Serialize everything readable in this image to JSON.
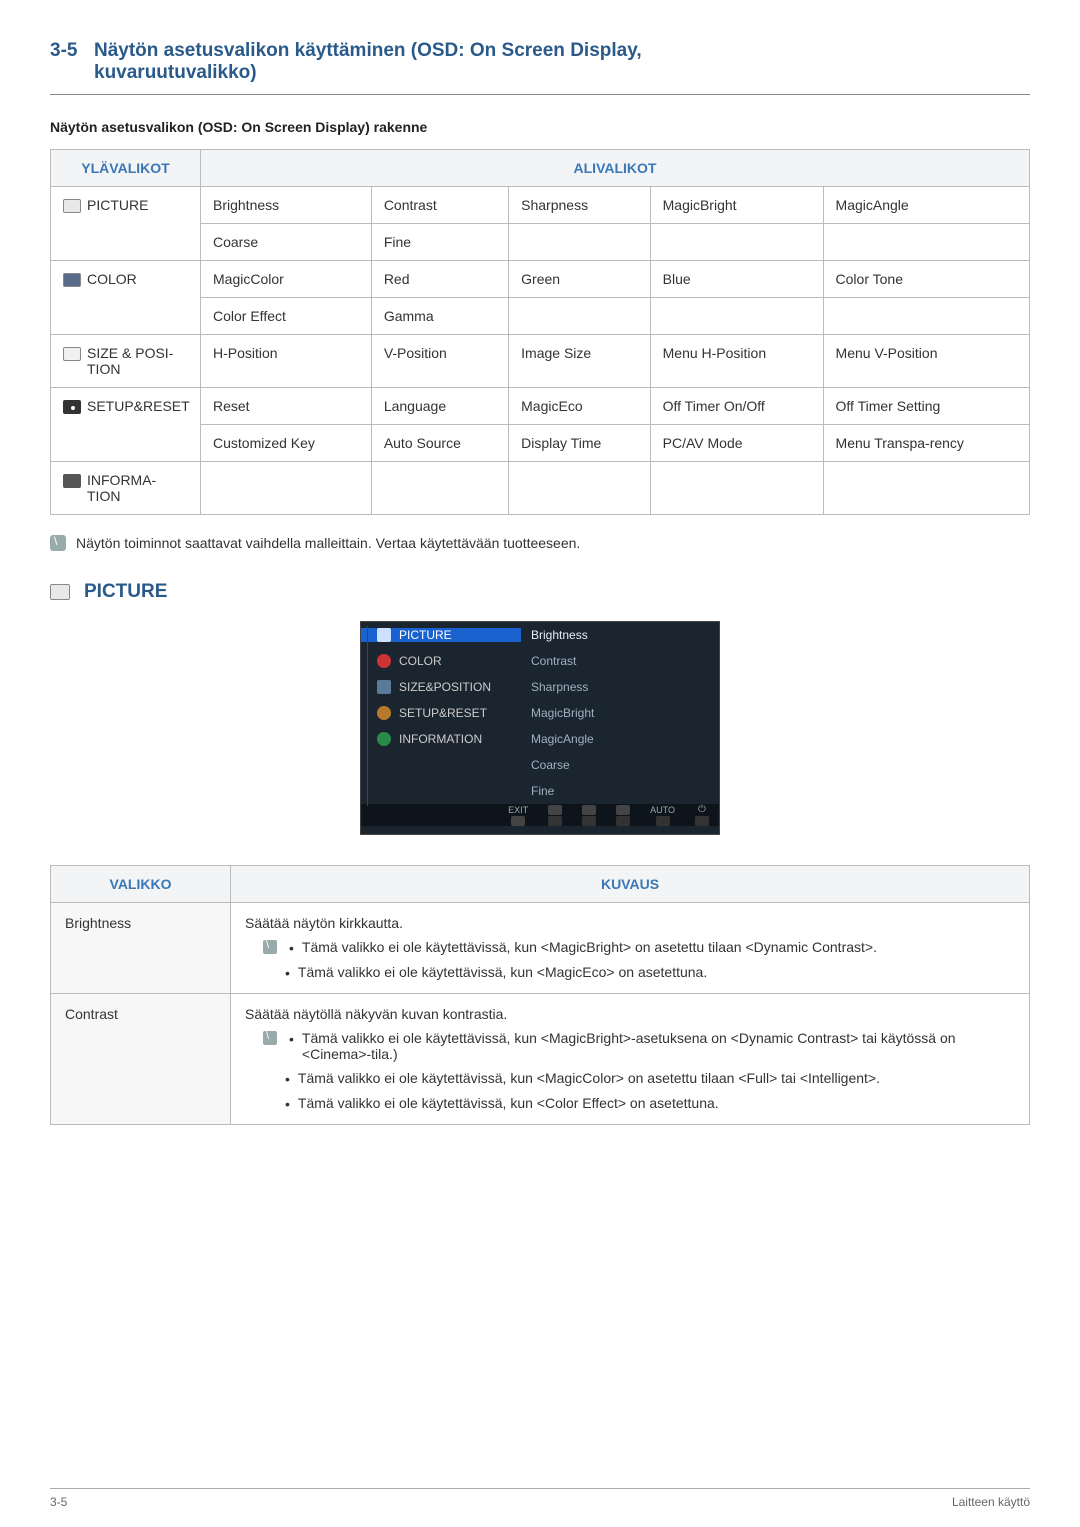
{
  "header": {
    "section_number": "3-5",
    "title_line1": "Näytön asetusvalikon käyttäminen (OSD: On Screen Display,",
    "title_line2": "kuvaruutuvalikko)"
  },
  "subheading": "Näytön asetusvalikon (OSD: On Screen Display) rakenne",
  "table1": {
    "head_menu": "YLÄVALIKOT",
    "head_sub": "ALIVALIKOT",
    "rows": [
      {
        "menu": "PICTURE",
        "cells": [
          [
            "Brightness",
            "Contrast",
            "Sharpness",
            "MagicBright",
            "MagicAngle"
          ],
          [
            "Coarse",
            "Fine",
            "",
            "",
            ""
          ]
        ]
      },
      {
        "menu": "COLOR",
        "cells": [
          [
            "MagicColor",
            "Red",
            "Green",
            "Blue",
            "Color Tone"
          ],
          [
            "Color Effect",
            "Gamma",
            "",
            "",
            ""
          ]
        ]
      },
      {
        "menu": "SIZE & POSI-TION",
        "cells": [
          [
            "H-Position",
            "V-Position",
            "Image Size",
            "Menu H-Position",
            "Menu V-Position"
          ]
        ]
      },
      {
        "menu": "SETUP&RESET",
        "cells": [
          [
            "Reset",
            "Language",
            "MagicEco",
            "Off Timer On/Off",
            "Off Timer Setting"
          ],
          [
            "Customized Key",
            "Auto Source",
            "Display Time",
            "PC/AV Mode",
            "Menu Transpa-rency"
          ]
        ]
      },
      {
        "menu": "INFORMA-TION",
        "cells": [
          [
            "",
            "",
            "",
            "",
            ""
          ]
        ]
      }
    ]
  },
  "note1": "Näytön toiminnot saattavat vaihdella malleittain. Vertaa käytettävään tuotteeseen.",
  "picture_heading": "PICTURE",
  "preview": {
    "left": [
      "PICTURE",
      "COLOR",
      "SIZE&POSITION",
      "SETUP&RESET",
      "INFORMATION"
    ],
    "right": [
      "Brightness",
      "Contrast",
      "Sharpness",
      "MagicBright",
      "MagicAngle",
      "Coarse",
      "Fine"
    ],
    "nav": [
      "EXIT",
      "",
      "",
      "",
      "AUTO",
      ""
    ]
  },
  "table2": {
    "head_menu": "VALIKKO",
    "head_desc": "KUVAUS",
    "rows": [
      {
        "menu": "Brightness",
        "intro": "Säätää näytön kirkkautta.",
        "notes": [
          "Tämä valikko ei ole käytettävissä, kun <MagicBright> on asetettu tilaan <Dynamic Contrast>.",
          "Tämä valikko ei ole käytettävissä, kun <MagicEco> on asetettuna."
        ]
      },
      {
        "menu": "Contrast",
        "intro": "Säätää näytöllä näkyvän kuvan kontrastia.",
        "notes": [
          "Tämä valikko ei ole käytettävissä, kun <MagicBright>-asetuksena on <Dynamic Contrast> tai käytössä on <Cinema>-tila.)",
          "Tämä valikko ei ole käytettävissä, kun <MagicColor> on asetettu tilaan <Full> tai <Intelligent>.",
          "Tämä valikko ei ole käytettävissä, kun <Color Effect> on asetettuna."
        ]
      }
    ]
  },
  "footer": {
    "left": "3-5",
    "right": "Laitteen käyttö"
  }
}
